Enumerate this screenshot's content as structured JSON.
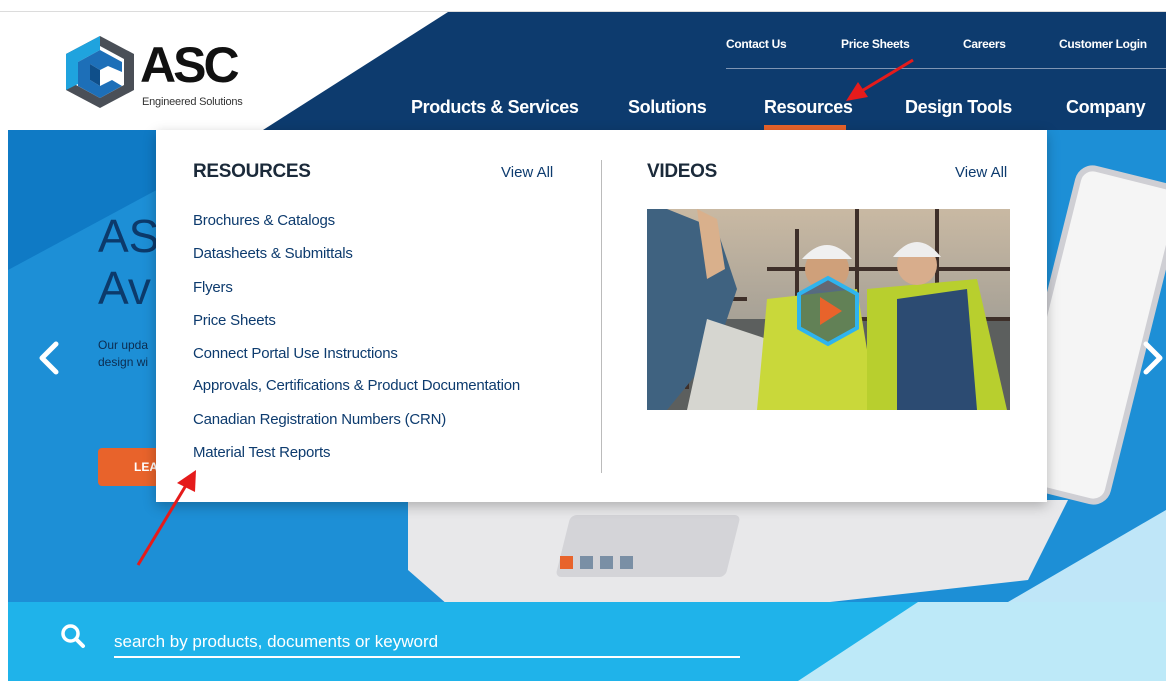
{
  "brand": {
    "name": "ASC",
    "tagline": "Engineered Solutions",
    "colors": {
      "navy": "#0d3b6e",
      "orange": "#e8632b",
      "hero_blue": "#1d8fd6",
      "search_blue": "#1fb3ea"
    }
  },
  "utility_nav": [
    {
      "label": "Contact Us"
    },
    {
      "label": "Price Sheets"
    },
    {
      "label": "Careers"
    },
    {
      "label": "Customer Login"
    }
  ],
  "main_nav": [
    {
      "label": "Products & Services"
    },
    {
      "label": "Solutions"
    },
    {
      "label": "Resources",
      "active": true
    },
    {
      "label": "Design Tools"
    },
    {
      "label": "Company"
    }
  ],
  "hero": {
    "title_line1": "AS",
    "title_line2": "Av",
    "desc_line1": "Our upda",
    "desc_line2": "design wi",
    "button_label": "LEA"
  },
  "dropdown": {
    "resources_heading": "RESOURCES",
    "resources_view_all": "View All",
    "links": [
      "Brochures & Catalogs",
      "Datasheets & Submittals",
      "Flyers",
      "Price Sheets",
      "Connect Portal Use Instructions",
      "Approvals, Certifications & Product Documentation",
      "Canadian Registration Numbers (CRN)",
      "Material Test Reports"
    ],
    "videos_heading": "VIDEOS",
    "videos_view_all": "View All",
    "video_icon": "play-icon"
  },
  "carousel": {
    "slide_count": 4,
    "active_index": 0
  },
  "search": {
    "placeholder": "search by products, documents or keyword",
    "icon": "search-icon"
  }
}
